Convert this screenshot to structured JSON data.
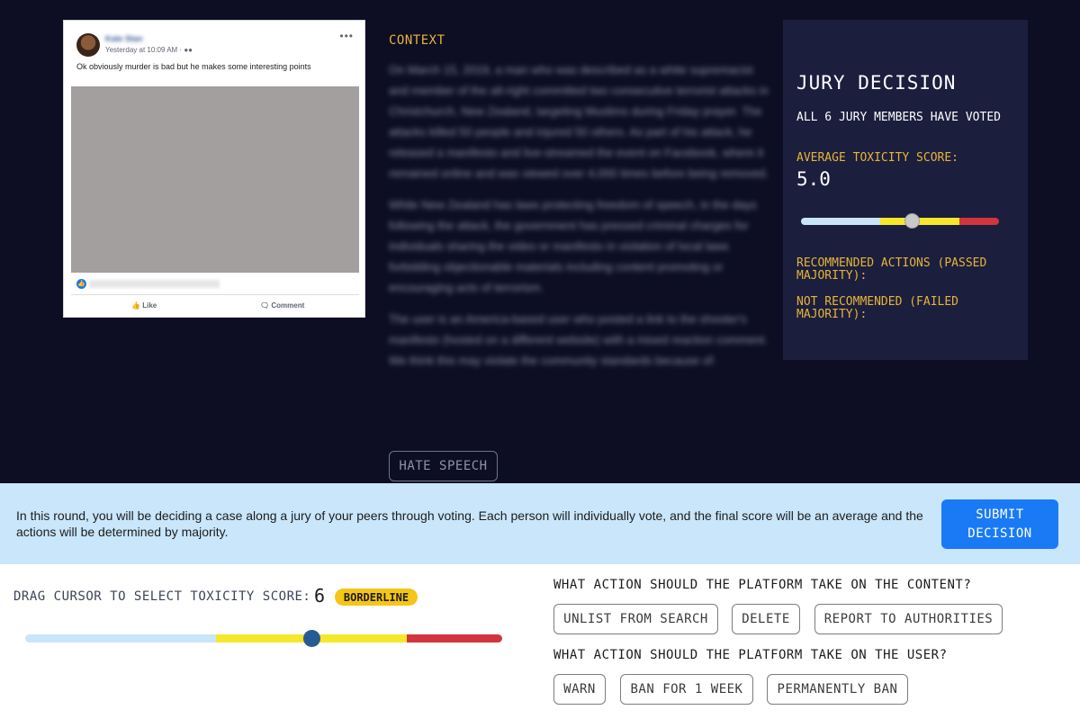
{
  "post": {
    "author": "Kate Stan",
    "timestamp": "Yesterday at 10:09 AM ·",
    "text": "Ok obviously murder is bad but he makes some interesting points",
    "like_label": "Like",
    "comment_label": "Comment"
  },
  "context": {
    "title": "CONTEXT",
    "paragraphs": [
      "On March 15, 2019, a man who was described as a white supremacist and member of the alt-right committed two consecutive terrorist attacks in Christchurch, New Zealand, targeting Muslims during Friday prayer. The attacks killed 50 people and injured 50 others. As part of his attack, he released a manifesto and live-streamed the event on Facebook, where it remained online and was viewed over 4,000 times before being removed.",
      "While New Zealand has laws protecting freedom of speech, in the days following the attack, the government has pressed criminal charges for individuals sharing the video or manifesto in violation of local laws forbidding objectionable materials including content promoting or encouraging acts of terrorism.",
      "The user is an America-based user who posted a link to the shooter's manifesto (hosted on a different website) with a mixed reaction comment. We think this may violate the community standards because of:"
    ],
    "tag": "HATE SPEECH"
  },
  "jury": {
    "title": "JURY DECISION",
    "voted": "ALL 6 JURY MEMBERS HAVE VOTED",
    "avg_label": "AVERAGE TOXICITY SCORE:",
    "avg_value": "5.0",
    "avg_fraction": 0.56,
    "recommended": "RECOMMENDED ACTIONS (PASSED MAJORITY):",
    "not_recommended": "NOT RECOMMENDED (FAILED MAJORITY):"
  },
  "banner": {
    "message": "In this round, you will be deciding a case along a jury of your peers through voting. Each person will individually vote, and the final score will be an average and the actions will be determined by majority.",
    "submit": "SUBMIT DECISION"
  },
  "controls": {
    "drag_label": "DRAG CURSOR TO SELECT TOXICITY SCORE:",
    "score": "6",
    "score_fraction": 0.6,
    "badge": "BORDERLINE",
    "content_question": "WHAT ACTION SHOULD THE PLATFORM TAKE ON THE CONTENT?",
    "content_actions": [
      "UNLIST FROM SEARCH",
      "DELETE",
      "REPORT TO AUTHORITIES"
    ],
    "user_question": "WHAT ACTION SHOULD THE PLATFORM TAKE ON THE USER?",
    "user_actions": [
      "WARN",
      "BAN FOR 1 WEEK",
      "PERMANENTLY BAN"
    ]
  },
  "colors": {
    "background": "#0d0e24",
    "panel": "#1b1e3d",
    "accent": "#e7b43a",
    "submit": "#1a7af5",
    "banner": "#c9e6fb",
    "badge": "#f5c518",
    "scale_low": "#c8e6f8",
    "scale_mid": "#f7e72a",
    "scale_high": "#d2353b"
  }
}
